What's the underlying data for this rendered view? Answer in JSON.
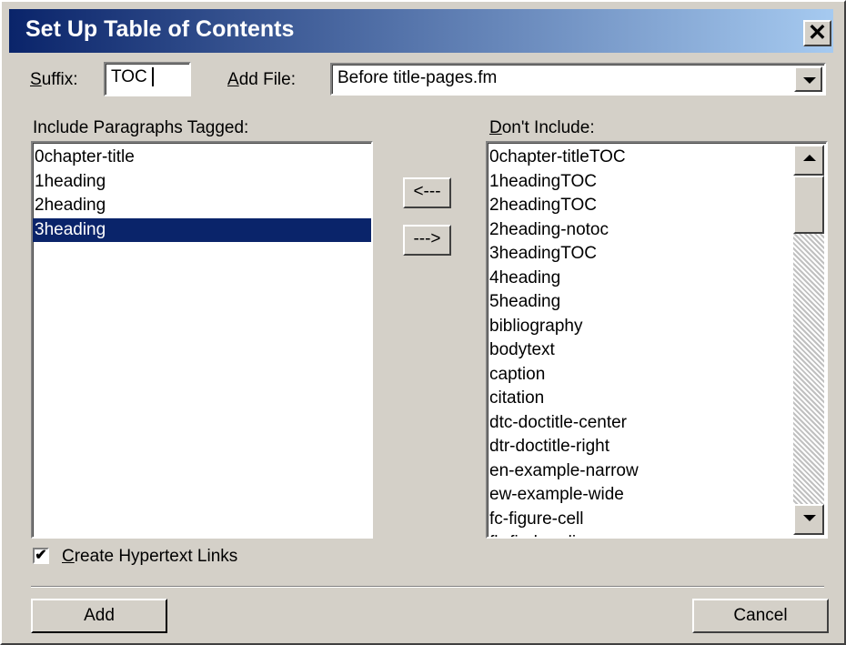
{
  "window": {
    "title": "Set Up Table of Contents",
    "close_label": "✕"
  },
  "suffix": {
    "label_accel": "S",
    "label_rest": "uffix:",
    "value": "TOC"
  },
  "add_file": {
    "label_accel": "A",
    "label_rest": "dd File:",
    "value": "Before title-pages.fm"
  },
  "include": {
    "label": "Include Paragraphs Tagged:",
    "items": [
      "0chapter-title",
      "1heading",
      "2heading",
      "3heading"
    ],
    "selected": "3heading"
  },
  "move_buttons": {
    "left_label": "<---",
    "right_label": "--->"
  },
  "exclude": {
    "label_accel": "D",
    "label_rest": "on't Include:",
    "items": [
      "0chapter-titleTOC",
      "1headingTOC",
      "2headingTOC",
      "2heading-notoc",
      "3headingTOC",
      "4heading",
      "5heading",
      "bibliography",
      "bodytext",
      "caption",
      "citation",
      "dtc-doctitle-center",
      "dtr-doctitle-right",
      "en-example-narrow",
      "ew-example-wide",
      "fc-figure-cell",
      "fh-fig-heading"
    ]
  },
  "hypertext": {
    "label_accel": "C",
    "label_rest": "reate Hypertext Links",
    "checked": true,
    "check_glyph": "✔"
  },
  "buttons": {
    "add": "Add",
    "cancel": "Cancel"
  },
  "colors": {
    "title_start": "#0a246a",
    "title_end": "#a6caf0",
    "selection": "#0a246a",
    "face": "#d4d0c8"
  },
  "icons": [
    "close-icon",
    "chevron-down-icon",
    "scroll-up-icon",
    "scroll-down-icon",
    "check-icon"
  ]
}
